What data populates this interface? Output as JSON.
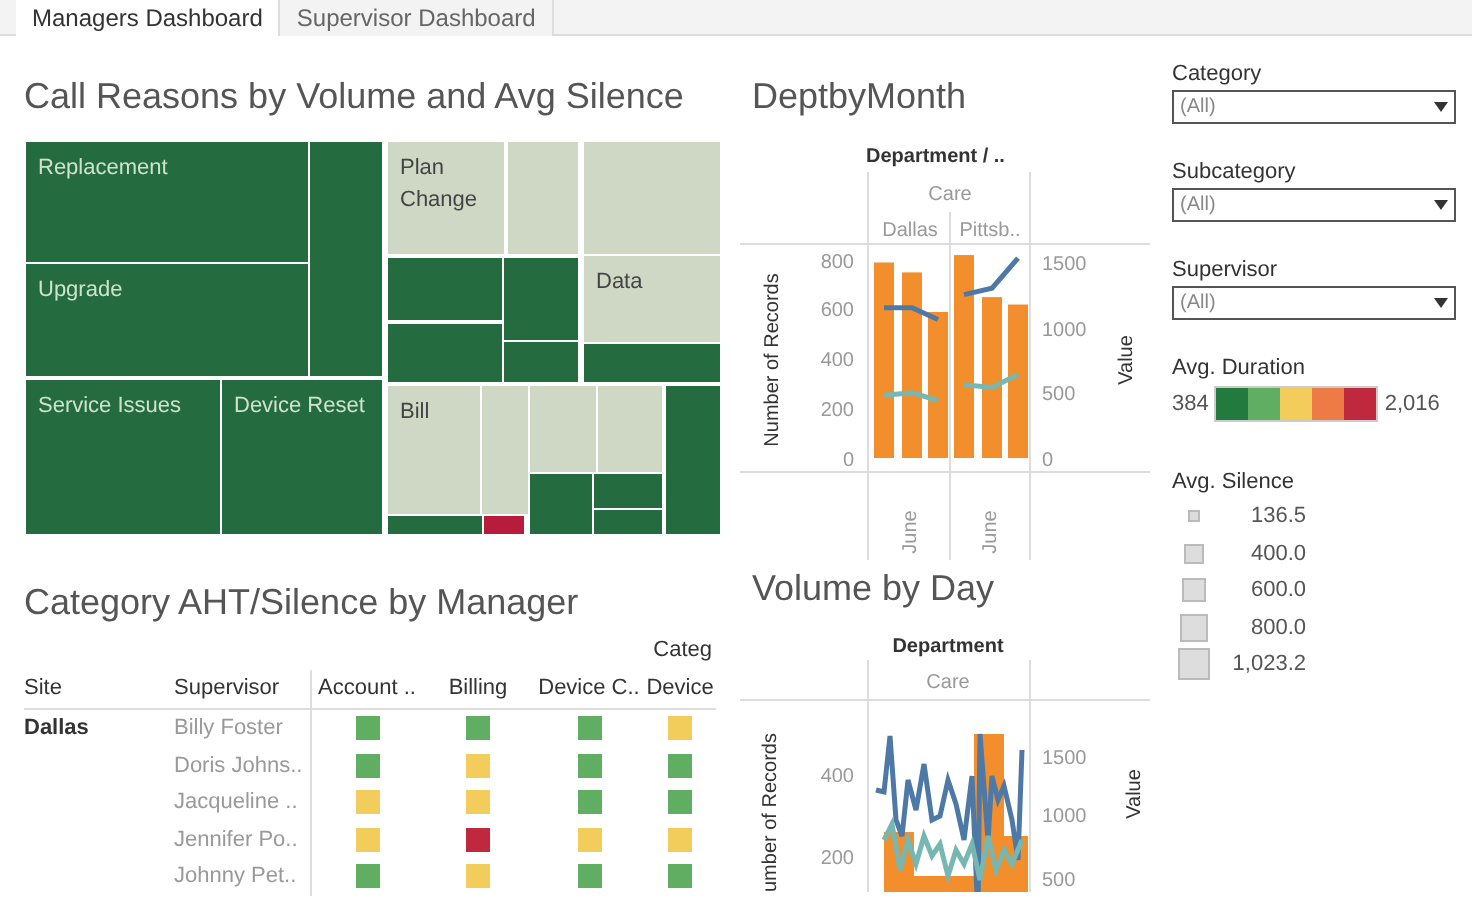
{
  "tabs": [
    {
      "label": "Managers Dashboard",
      "selected": true
    },
    {
      "label": "Supervisor Dashboard",
      "selected": false
    }
  ],
  "treemap": {
    "title": "Call Reasons by Volume and Avg Silence",
    "tiles": [
      {
        "label": "Replacement",
        "color": "#246b3f"
      },
      {
        "label": "Upgrade",
        "color": "#246b3f"
      },
      {
        "color": "#246b3f"
      },
      {
        "label": "Service Issues",
        "color": "#246b3f"
      },
      {
        "label": "Device Reset",
        "color": "#246b3f"
      },
      {
        "label": "Plan Change",
        "color": "#cfd7c5"
      },
      {
        "color": "#cfd7c5"
      },
      {
        "color": "#cfd7c5"
      },
      {
        "color": "#246b3f"
      },
      {
        "color": "#246b3f"
      },
      {
        "color": "#246b3f"
      },
      {
        "color": "#246b3f"
      },
      {
        "label": "Data",
        "color": "#cfd7c5"
      },
      {
        "color": "#246b3f"
      },
      {
        "label": "Bill",
        "color": "#cfd7c5"
      },
      {
        "color": "#246b3f"
      },
      {
        "color": "#cfd7c5"
      },
      {
        "color": "#b81c3c"
      },
      {
        "color": "#cfd7c5"
      },
      {
        "color": "#cfd7c5"
      },
      {
        "color": "#246b3f"
      },
      {
        "color": "#246b3f"
      },
      {
        "color": "#246b3f"
      },
      {
        "color": "#246b3f"
      }
    ]
  },
  "dept_by_month": {
    "title": "DeptbyMonth",
    "header": "Department / ..",
    "group": "Care",
    "panels": [
      "Dallas",
      "Pittsb.."
    ],
    "month_labels": [
      "June",
      "June"
    ],
    "ylabel": "Number of Records",
    "y2label": "Value",
    "yticks": [
      "800",
      "600",
      "400",
      "200",
      "0"
    ],
    "y2ticks": [
      "1500",
      "1000",
      "500",
      "0"
    ]
  },
  "aht_table": {
    "title": "Category AHT/Silence by Manager",
    "group_header": "Categ",
    "columns": [
      "Site",
      "Supervisor",
      "Account ..",
      "Billing",
      "Device C..",
      "Device"
    ],
    "rows": [
      {
        "site": "Dallas",
        "supervisor": "Billy Foster",
        "cells": [
          {
            "color": "#5fae62"
          },
          {
            "color": "#5fae62"
          },
          {
            "color": "#5fae62"
          },
          {
            "color": "#f2cd5c"
          }
        ]
      },
      {
        "supervisor": "Doris Johns..",
        "cells": [
          {
            "color": "#5fae62"
          },
          {
            "color": "#f2cd5c"
          },
          {
            "color": "#5fae62"
          },
          {
            "color": "#5fae62"
          }
        ]
      },
      {
        "supervisor": "Jacqueline ..",
        "cells": [
          {
            "color": "#f2cd5c"
          },
          {
            "color": "#f2cd5c"
          },
          {
            "color": "#5fae62"
          },
          {
            "color": "#5fae62"
          }
        ]
      },
      {
        "supervisor": "Jennifer Po..",
        "cells": [
          {
            "color": "#f2cd5c"
          },
          {
            "color": "#c0283e"
          },
          {
            "color": "#f2cd5c"
          },
          {
            "color": "#f2cd5c"
          }
        ]
      },
      {
        "supervisor": "Johnny Pet..",
        "cells": [
          {
            "color": "#5fae62"
          },
          {
            "color": "#f2cd5c"
          },
          {
            "color": "#5fae62"
          },
          {
            "color": "#5fae62"
          }
        ]
      }
    ]
  },
  "volume_by_day": {
    "title": "Volume by Day",
    "header": "Department",
    "group": "Care",
    "ylabel": "umber of Records",
    "yticks": [
      "400",
      "200"
    ],
    "y2label": "Value",
    "y2ticks": [
      "1500",
      "1000",
      "500"
    ]
  },
  "filters": [
    {
      "label": "Category",
      "value": "(All)"
    },
    {
      "label": "Subcategory",
      "value": "(All)"
    },
    {
      "label": "Supervisor",
      "value": "(All)"
    }
  ],
  "duration_legend": {
    "title": "Avg. Duration",
    "min": "384",
    "max": "2,016",
    "swatches": [
      {
        "color": "#237a3f"
      },
      {
        "color": "#5fae62"
      },
      {
        "color": "#f2cd5c"
      },
      {
        "color": "#ee7b45"
      },
      {
        "color": "#c0283e"
      }
    ]
  },
  "silence_legend": {
    "title": "Avg. Silence",
    "items": [
      "136.5",
      "400.0",
      "600.0",
      "800.0",
      "1,023.2"
    ]
  }
}
